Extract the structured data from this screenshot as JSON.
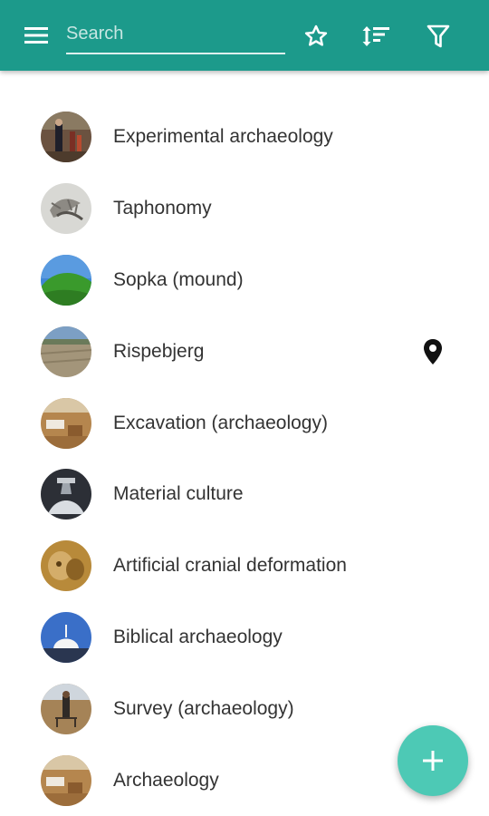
{
  "colors": {
    "toolbar": "#1c9a8b",
    "fab": "#4dc9b5",
    "text": "#333333"
  },
  "toolbar": {
    "menu_icon": "hamburger-menu-icon",
    "search_placeholder": "Search",
    "search_value": "",
    "favorite_icon": "star-outline-icon",
    "sort_icon": "sort-icon",
    "filter_icon": "filter-icon"
  },
  "items": [
    {
      "label": "Experimental archaeology",
      "avatar_icon": "photo-thumbnail"
    },
    {
      "label": "Taphonomy",
      "avatar_icon": "photo-thumbnail"
    },
    {
      "label": "Sopka (mound)",
      "avatar_icon": "photo-thumbnail"
    },
    {
      "label": "Rispebjerg",
      "avatar_icon": "photo-thumbnail",
      "trailing_icon": "location-pin-icon"
    },
    {
      "label": "Excavation (archaeology)",
      "avatar_icon": "photo-thumbnail"
    },
    {
      "label": "Material culture",
      "avatar_icon": "photo-thumbnail"
    },
    {
      "label": "Artificial cranial deformation",
      "avatar_icon": "photo-thumbnail"
    },
    {
      "label": "Biblical archaeology",
      "avatar_icon": "photo-thumbnail"
    },
    {
      "label": "Survey (archaeology)",
      "avatar_icon": "photo-thumbnail"
    },
    {
      "label": "Archaeology",
      "avatar_icon": "photo-thumbnail"
    }
  ],
  "fab": {
    "icon": "plus-icon"
  }
}
